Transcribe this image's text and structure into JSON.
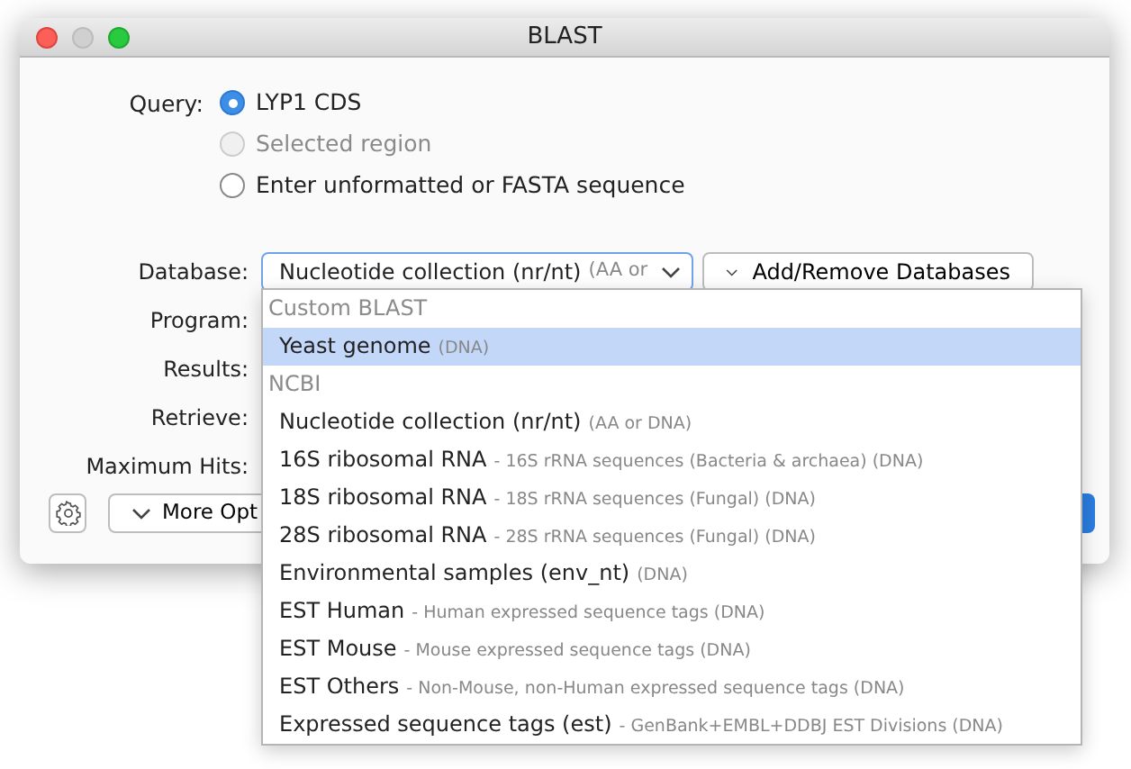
{
  "window": {
    "title": "BLAST"
  },
  "query": {
    "label": "Query:",
    "options": [
      {
        "label": "LYP1 CDS",
        "selected": true,
        "disabled": false
      },
      {
        "label": "Selected region",
        "selected": false,
        "disabled": true
      },
      {
        "label": "Enter unformatted or FASTA sequence",
        "selected": false,
        "disabled": false
      }
    ]
  },
  "database": {
    "label": "Database:",
    "value": "Nucleotide collection (nr/nt)",
    "value_detail": "(AA or",
    "add_remove_button": "Add/Remove Databases"
  },
  "field_labels": [
    "Program:",
    "Results:",
    "Retrieve:",
    "Maximum Hits:"
  ],
  "more_options_button": "More Opt",
  "dropdown": [
    {
      "kind": "heading",
      "name": "Custom BLAST"
    },
    {
      "kind": "option",
      "name": "Yeast genome",
      "detail": "(DNA)",
      "selected": true
    },
    {
      "kind": "heading",
      "name": "NCBI"
    },
    {
      "kind": "option",
      "name": "Nucleotide collection (nr/nt)",
      "detail": "(AA or DNA)",
      "selected": false
    },
    {
      "kind": "option",
      "name": "16S ribosomal RNA",
      "detail": "- 16S rRNA sequences (Bacteria & archaea) (DNA)",
      "selected": false
    },
    {
      "kind": "option",
      "name": "18S ribosomal RNA",
      "detail": "- 18S rRNA sequences (Fungal) (DNA)",
      "selected": false
    },
    {
      "kind": "option",
      "name": "28S ribosomal RNA",
      "detail": "- 28S rRNA sequences (Fungal) (DNA)",
      "selected": false
    },
    {
      "kind": "option",
      "name": "Environmental samples (env_nt)",
      "detail": "(DNA)",
      "selected": false
    },
    {
      "kind": "option",
      "name": "EST Human",
      "detail": "- Human expressed sequence tags (DNA)",
      "selected": false
    },
    {
      "kind": "option",
      "name": "EST Mouse",
      "detail": "- Mouse expressed sequence tags (DNA)",
      "selected": false
    },
    {
      "kind": "option",
      "name": "EST Others",
      "detail": "- Non-Mouse, non-Human expressed sequence tags (DNA)",
      "selected": false
    },
    {
      "kind": "option",
      "name": "Expressed sequence tags (est)",
      "detail": "- GenBank+EMBL+DDBJ EST Divisions (DNA)",
      "selected": false
    }
  ]
}
